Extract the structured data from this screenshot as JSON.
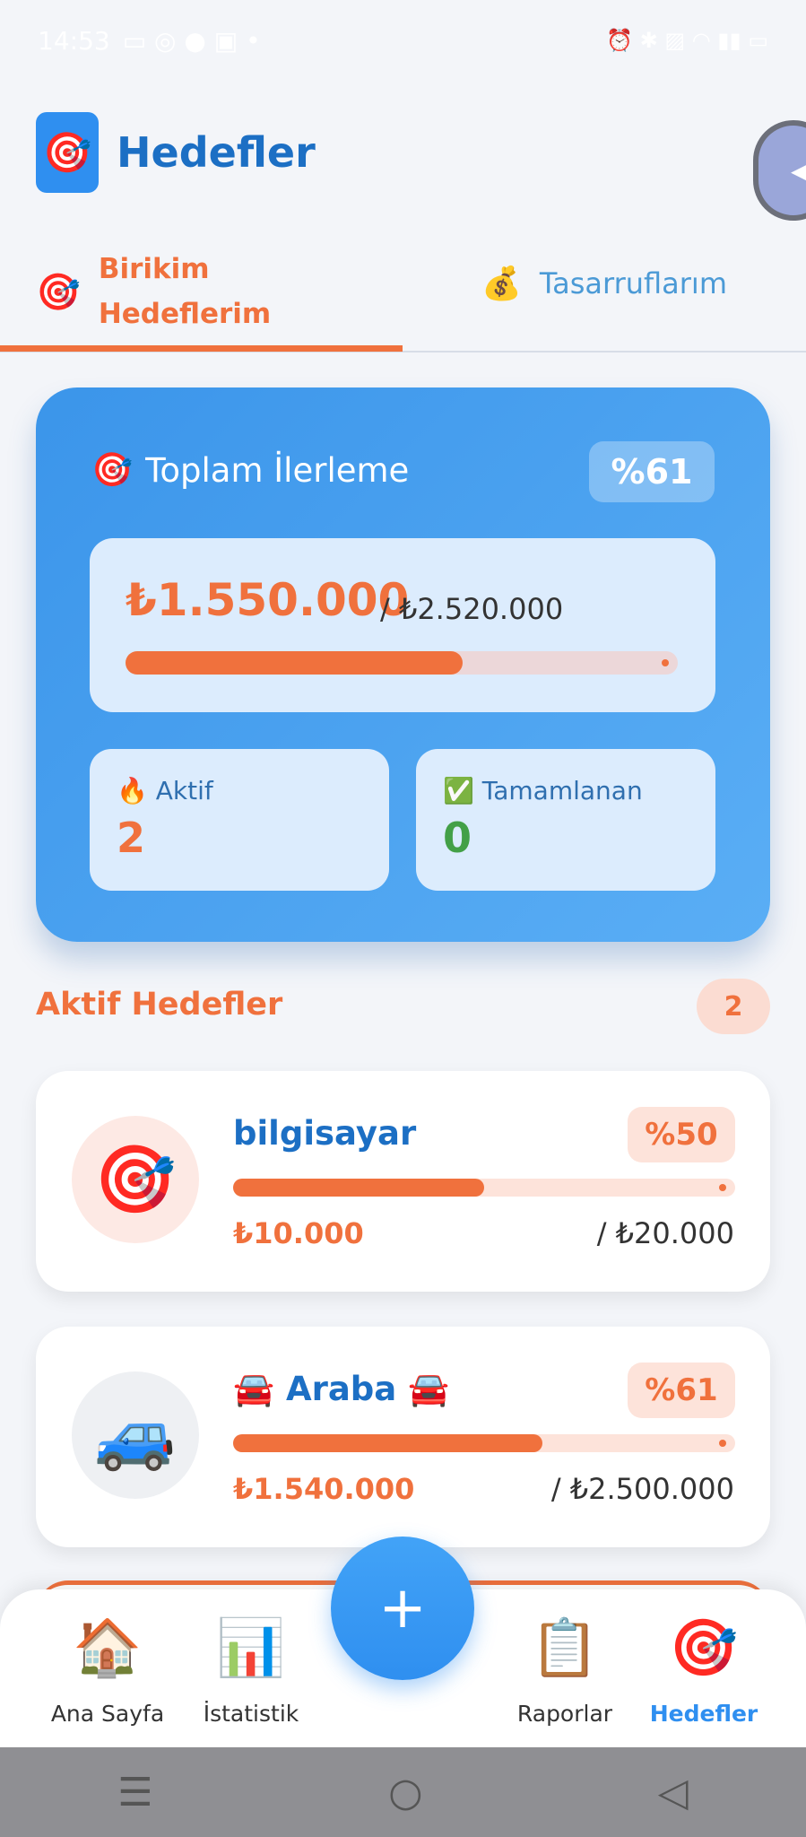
{
  "status_bar": {
    "time": "14:53",
    "icons_left": "▭ ◎ ● ▣ •",
    "icons_right": "⏰ ✱ ▨ ◠ ▮▮ ▭"
  },
  "header": {
    "logo_icon": "🎯",
    "title": "Hedefler"
  },
  "side_handle": {
    "icon": "◀"
  },
  "tabs": [
    {
      "icon": "🎯",
      "label": "Birikim Hedeflerim",
      "active": true
    },
    {
      "icon": "💰",
      "label": "Tasarruflarım",
      "active": false
    }
  ],
  "summary": {
    "title_icon": "🎯",
    "title": "Toplam İlerleme",
    "percent_label": "%61",
    "progress": 0.61,
    "current": "₺1.550.000",
    "target": "/ ₺2.520.000",
    "active": {
      "icon": "🔥",
      "label": "Aktif",
      "value": "2"
    },
    "completed": {
      "icon": "✅",
      "label": "Tamamlanan",
      "value": "0"
    }
  },
  "section": {
    "title": "Aktif Hedefler",
    "count": "2"
  },
  "goals": [
    {
      "icon": "🎯",
      "name": "bilgisayar",
      "percent_label": "%50",
      "progress": 0.5,
      "current": "₺10.000",
      "target": "/ ₺20.000"
    },
    {
      "icon": "🚙",
      "name": "🚘 Araba 🚘",
      "percent_label": "%61",
      "progress": 0.616,
      "current": "₺1.540.000",
      "target": "/ ₺2.500.000"
    }
  ],
  "fab": {
    "label": "+"
  },
  "bottom_nav": [
    {
      "icon": "🏠",
      "label": "Ana Sayfa",
      "active": false
    },
    {
      "icon": "📊",
      "label": "İstatistik",
      "active": false
    },
    {
      "icon": "📋",
      "label": "Raporlar",
      "active": false
    },
    {
      "icon": "🎯",
      "label": "Hedefler",
      "active": true
    }
  ],
  "system_nav": {
    "menu": "☰",
    "home": "○",
    "back": "◁"
  },
  "colors": {
    "accent": "#f0713d",
    "primary": "#2f8ff0",
    "success": "#43a047",
    "title_blue": "#1c6fc4"
  }
}
